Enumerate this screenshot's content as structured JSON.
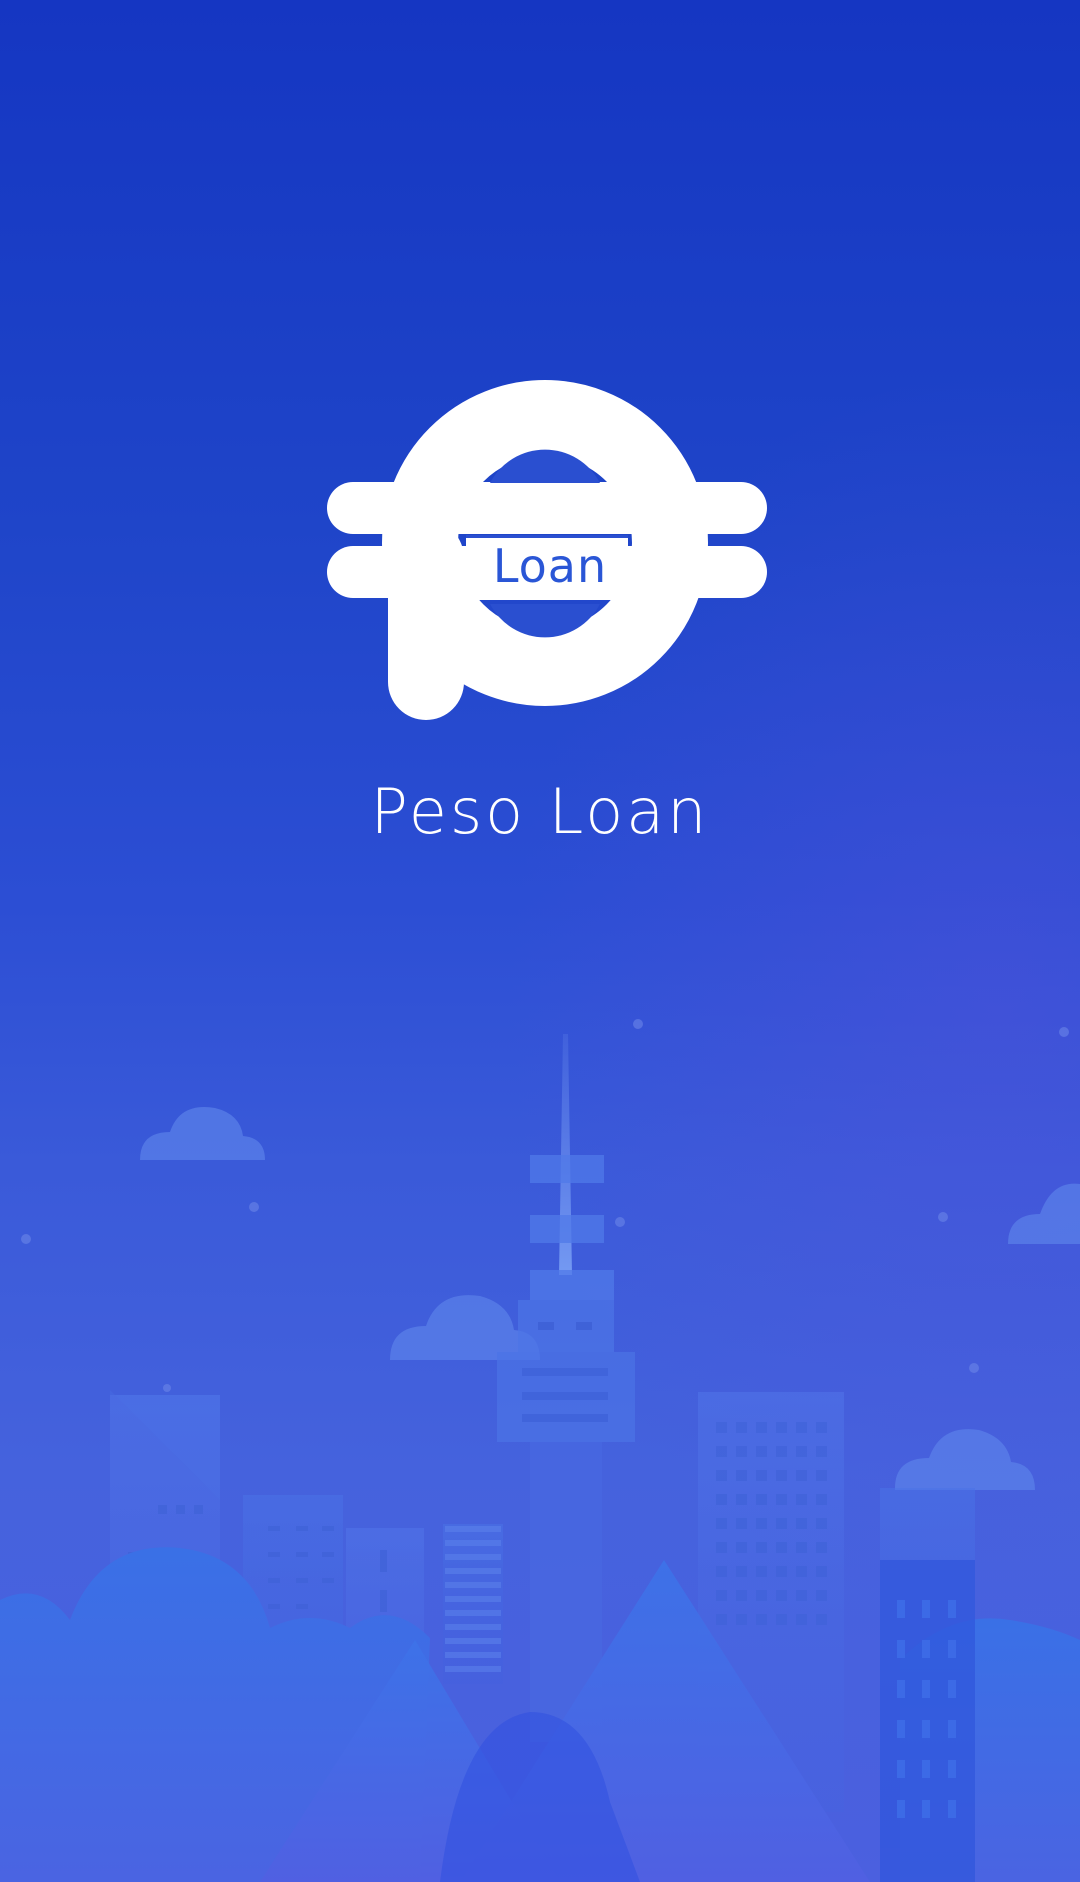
{
  "logo": {
    "word": "Loan"
  },
  "app": {
    "title": "Peso Loan"
  },
  "colors": {
    "background_top": "#1536c2",
    "background_bottom": "#4b60df",
    "logo_fill": "#ffffff",
    "logo_text": "#2a56d6"
  },
  "illustration": {
    "icon": "city-skyline-illustration"
  }
}
